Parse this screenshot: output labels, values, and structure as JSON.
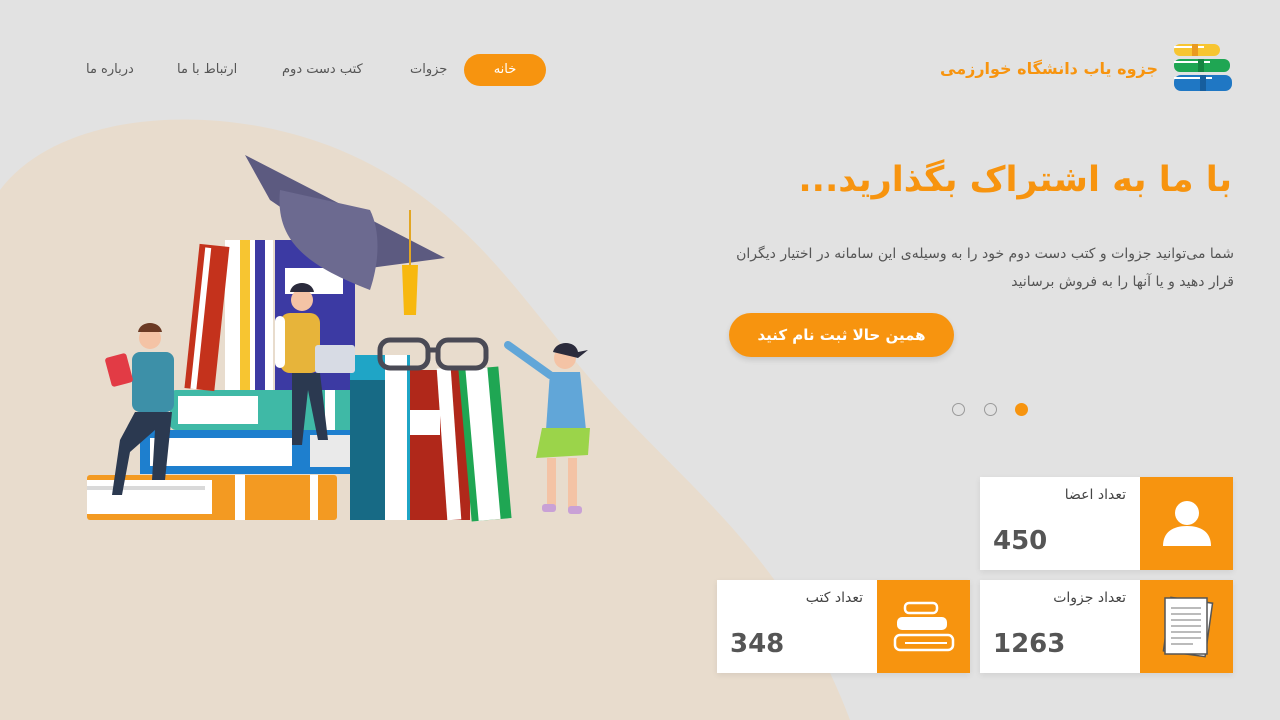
{
  "brand": {
    "title": "جزوه یاب دانشگاه خوارزمی",
    "logo": "stacked-books-logo"
  },
  "nav": {
    "home": "خانه",
    "notes": "جزوات",
    "used_books": "کتب دست دوم",
    "contact": "ارتباط با ما",
    "about": "درباره ما"
  },
  "hero": {
    "title": "با ما به اشتراک بگذارید...",
    "description": "شما می‌توانید جزوات و کتب دست دوم خود را به وسیله‌ی این سامانه در اختیار دیگران قرار دهید و یا آنها را به فروش برسانید",
    "cta": "همین حالا ثبت نام کنید"
  },
  "slider": {
    "count": 3,
    "active": 3
  },
  "stats": {
    "members": {
      "label": "تعداد اعضا",
      "value": "450",
      "icon": "user-icon"
    },
    "notes": {
      "label": "تعداد جزوات",
      "value": "1263",
      "icon": "notes-icon"
    },
    "books": {
      "label": "تعداد کتب",
      "value": "348",
      "icon": "books-icon"
    }
  },
  "colors": {
    "accent": "#f7940f",
    "background": "#e2e2e2",
    "blob": "#e8dccd"
  }
}
